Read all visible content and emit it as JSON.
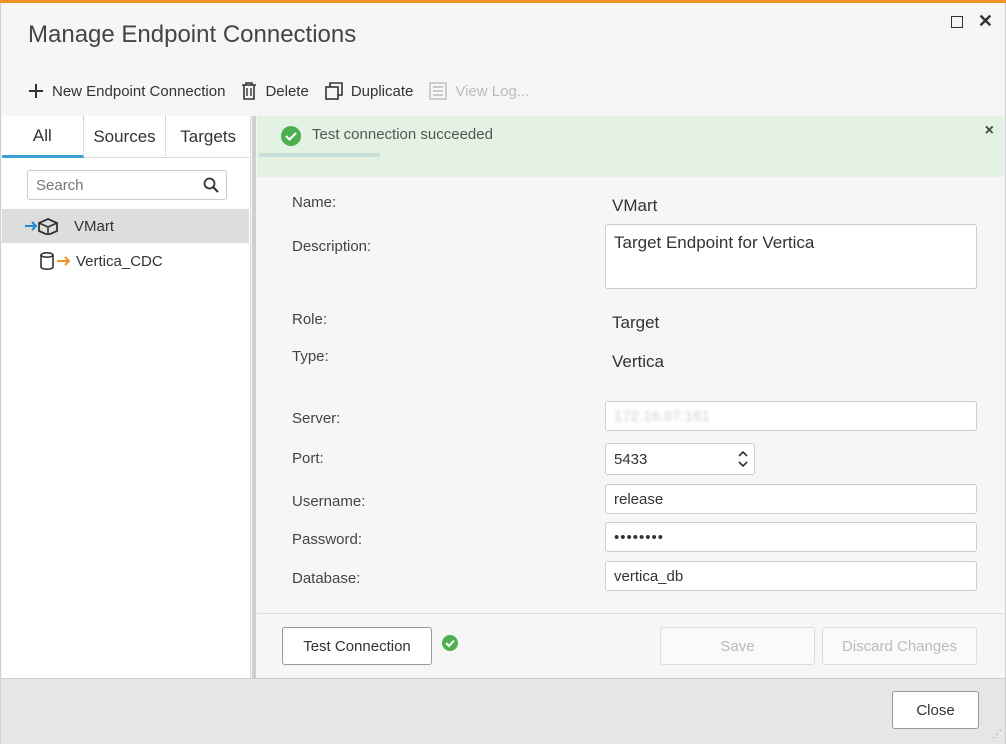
{
  "dialog": {
    "title": "Manage Endpoint Connections",
    "accent_color": "#f0922b"
  },
  "toolbar": {
    "new_label": "New Endpoint Connection",
    "delete_label": "Delete",
    "duplicate_label": "Duplicate",
    "viewlog_label": "View Log..."
  },
  "tabs": {
    "all": "All",
    "sources": "Sources",
    "targets": "Targets"
  },
  "search": {
    "placeholder": "Search"
  },
  "endpoints": [
    {
      "name": "VMart",
      "icon": "target-cube-icon",
      "selected": true
    },
    {
      "name": "Vertica_CDC",
      "icon": "source-database-icon",
      "selected": false
    }
  ],
  "banner": {
    "message": "Test connection succeeded",
    "close": "×",
    "color": "#e3f2e3"
  },
  "form": {
    "name_label": "Name:",
    "name_value": "VMart",
    "description_label": "Description:",
    "description_value": "Target Endpoint for Vertica",
    "role_label": "Role:",
    "role_value": "Target",
    "type_label": "Type:",
    "type_value": "Vertica",
    "server_label": "Server:",
    "server_value": "172.16.67.161",
    "port_label": "Port:",
    "port_value": "5433",
    "username_label": "Username:",
    "username_value": "release",
    "password_label": "Password:",
    "password_value": "••••••••",
    "database_label": "Database:",
    "database_value": "vertica_db"
  },
  "actions": {
    "test_label": "Test Connection",
    "save_label": "Save",
    "discard_label": "Discard Changes",
    "close_label": "Close"
  }
}
